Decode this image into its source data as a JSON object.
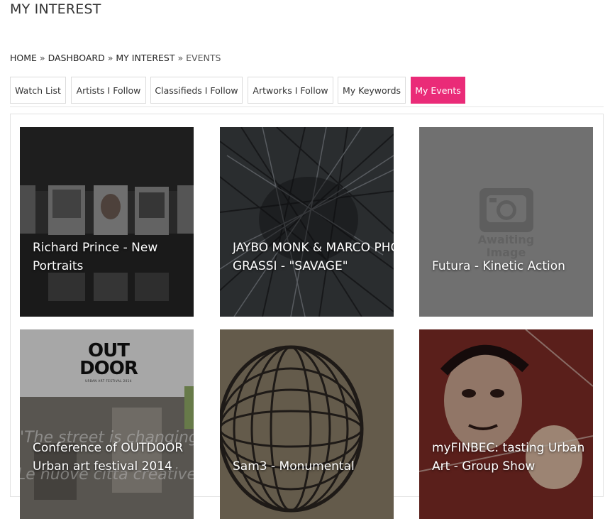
{
  "page": {
    "title": "MY INTEREST"
  },
  "breadcrumb": {
    "items": [
      "HOME",
      "DASHBOARD",
      "MY INTEREST"
    ],
    "current": "EVENTS",
    "separator": "»"
  },
  "tabs": [
    {
      "label": "Watch List",
      "active": false
    },
    {
      "label": "Artists I Follow",
      "active": false
    },
    {
      "label": "Classifieds I Follow",
      "active": false
    },
    {
      "label": "Artworks I Follow",
      "active": false
    },
    {
      "label": "My Keywords",
      "active": false
    },
    {
      "label": "My Events",
      "active": true
    }
  ],
  "events": [
    {
      "title": "Richard Prince - New\nPortraits"
    },
    {
      "title": "JAYBO MONK & MARCO PHOTOS\nGRASSI - \"SAVAGE\""
    },
    {
      "title": "Futura - Kinetic Action",
      "placeholder_text": "Awaiting\nImage"
    },
    {
      "title": "Conference of OUTDOOR\nUrban art festival 2014",
      "logo_text": "OUT\nDOOR",
      "logo_subtitle": "URBAN ART FESTIVAL 2014",
      "image_text_1": "\"The street is changing\"",
      "image_text_2": "Le nuove citta creative"
    },
    {
      "title": "Sam3 - Monumental"
    },
    {
      "title": "myFINBEC: tasting Urban\nArt - Group Show"
    }
  ],
  "colors": {
    "accent": "#ea2b78"
  }
}
